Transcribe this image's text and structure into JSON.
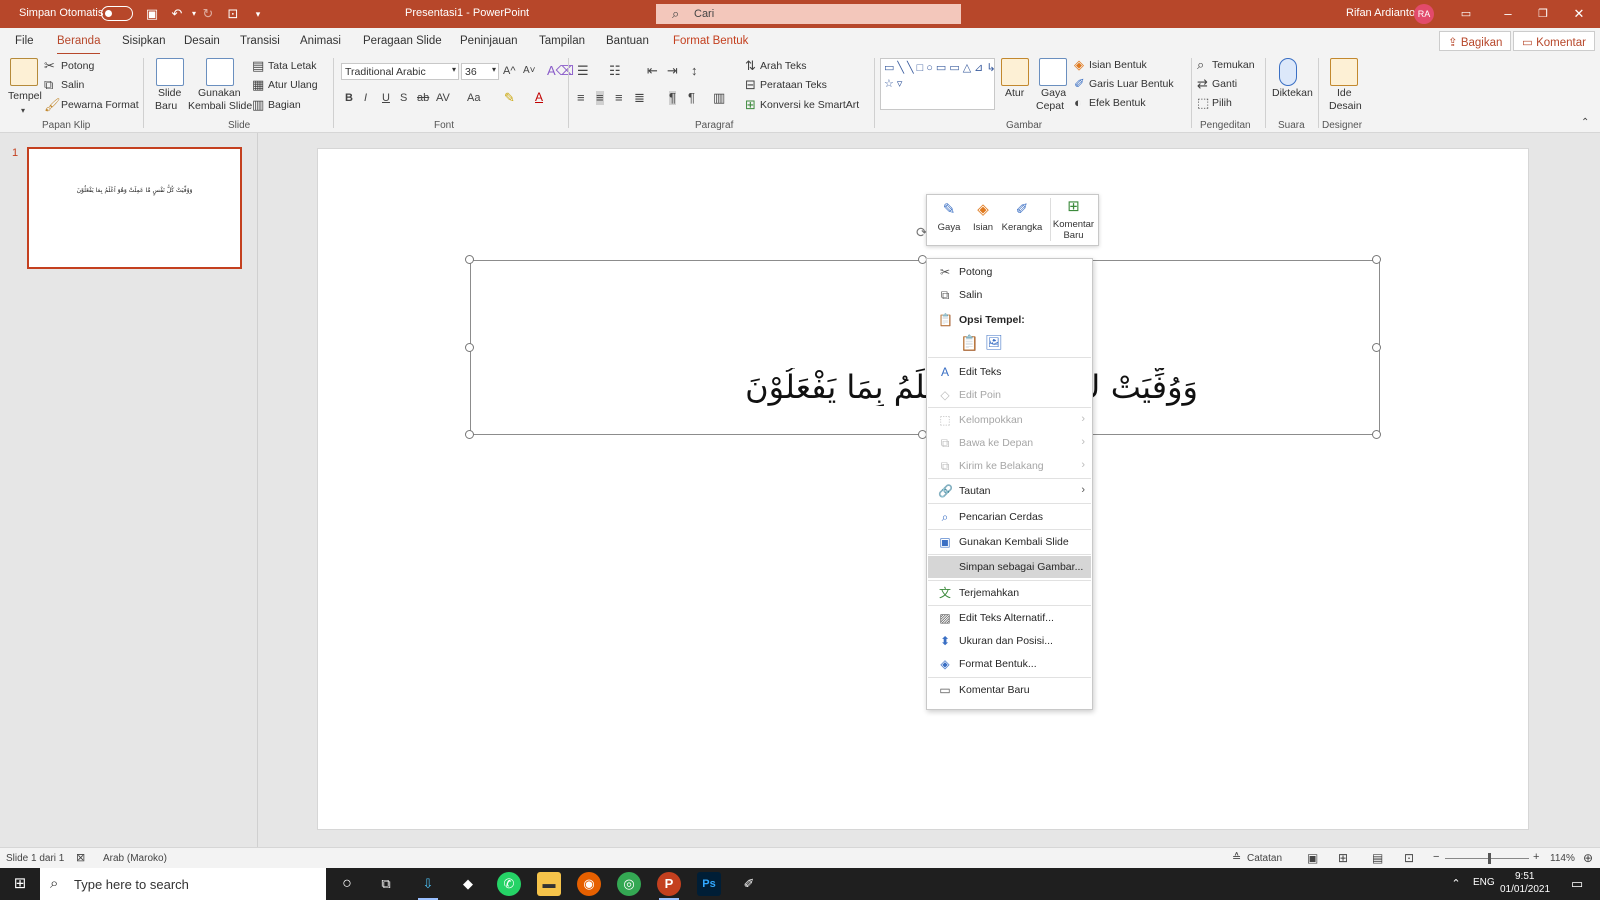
{
  "titlebar": {
    "autosave_label": "Simpan Otomatis",
    "doc_title": "Presentasi1  -  PowerPoint",
    "search_placeholder": "Cari",
    "user_name": "Rifan Ardianto",
    "user_initials": "RA",
    "colors": {
      "accent": "#b7472a"
    }
  },
  "tabs": [
    {
      "label": "File"
    },
    {
      "label": "Beranda",
      "active": true
    },
    {
      "label": "Sisipkan"
    },
    {
      "label": "Desain"
    },
    {
      "label": "Transisi"
    },
    {
      "label": "Animasi"
    },
    {
      "label": "Peragaan Slide"
    },
    {
      "label": "Peninjauan"
    },
    {
      "label": "Tampilan"
    },
    {
      "label": "Bantuan"
    },
    {
      "label": "Format Bentuk"
    }
  ],
  "share": {
    "bagikan": "Bagikan",
    "komentar": "Komentar"
  },
  "ribbon": {
    "clipboard": {
      "paste": "Tempel",
      "cut": "Potong",
      "copy": "Salin",
      "format_painter": "Pewarna Format",
      "group": "Papan Klip"
    },
    "slides": {
      "new_slide_1": "Slide",
      "new_slide_2": "Baru",
      "reuse_1": "Gunakan",
      "reuse_2": "Kembali Slide",
      "layout": "Tata Letak",
      "reset": "Atur Ulang",
      "section": "Bagian",
      "group": "Slide"
    },
    "font": {
      "name": "Traditional Arabic",
      "size": "36",
      "group": "Font"
    },
    "paragraph": {
      "text_direction": "Arah Teks",
      "align_text": "Perataan Teks",
      "smartart": "Konversi ke SmartArt",
      "group": "Paragraf"
    },
    "drawing": {
      "arrange": "Atur",
      "quick_styles_1": "Gaya",
      "quick_styles_2": "Cepat",
      "fill": "Isian Bentuk",
      "outline": "Garis Luar Bentuk",
      "effects": "Efek Bentuk",
      "group": "Gambar"
    },
    "editing": {
      "find": "Temukan",
      "replace": "Ganti",
      "select": "Pilih",
      "group": "Pengeditan"
    },
    "voice": {
      "dictate": "Diktekan",
      "group": "Suara"
    },
    "designer": {
      "ideas_1": "Ide",
      "ideas_2": "Desain",
      "group": "Designer"
    }
  },
  "thumbnail": {
    "number": "1",
    "text": "وَوُفِّيَتْ كُلُّ نَفْسٍ مَّا عَمِلَتْ وَهُوَ اَعْلَمُ بِمَا يَفْعَلُوْنَ"
  },
  "slide": {
    "text": "وَوُفِّيَتْ كُ لَتْ وَهُوَ اَعْلَمُ بِمَا يَفْعَلُوْنَ"
  },
  "mini_toolbar": {
    "style": "Gaya",
    "fill": "Isian",
    "outline": "Kerangka",
    "comment_1": "Komentar",
    "comment_2": "Baru"
  },
  "context_menu": [
    {
      "label": "Potong",
      "icon": "scissors-icon",
      "enabled": true
    },
    {
      "label": "Salin",
      "icon": "copy-icon",
      "enabled": true
    },
    {
      "label": "Opsi Tempel:",
      "icon": "paste-options-icon",
      "header": true
    },
    {
      "label": "Edit Teks",
      "icon": "edit-text-icon",
      "enabled": true
    },
    {
      "label": "Edit Poin",
      "icon": "edit-points-icon",
      "enabled": false
    },
    {
      "label": "Kelompokkan",
      "icon": "group-icon",
      "enabled": false,
      "submenu": true
    },
    {
      "label": "Bawa ke Depan",
      "icon": "bring-front-icon",
      "enabled": false,
      "submenu": true
    },
    {
      "label": "Kirim ke Belakang",
      "icon": "send-back-icon",
      "enabled": false,
      "submenu": true
    },
    {
      "label": "Tautan",
      "icon": "link-icon",
      "enabled": true,
      "submenu": true
    },
    {
      "label": "Pencarian Cerdas",
      "icon": "smart-lookup-icon",
      "enabled": true
    },
    {
      "label": "Gunakan Kembali Slide",
      "icon": "reuse-slides-icon",
      "enabled": true
    },
    {
      "label": "Simpan sebagai Gambar...",
      "icon": "",
      "enabled": true,
      "highlighted": true
    },
    {
      "label": "Terjemahkan",
      "icon": "translate-icon",
      "enabled": true
    },
    {
      "label": "Edit Teks Alternatif...",
      "icon": "alt-text-icon",
      "enabled": true
    },
    {
      "label": "Ukuran dan Posisi...",
      "icon": "size-position-icon",
      "enabled": true
    },
    {
      "label": "Format Bentuk...",
      "icon": "format-shape-icon",
      "enabled": true
    },
    {
      "label": "Komentar Baru",
      "icon": "new-comment-icon",
      "enabled": true
    }
  ],
  "status": {
    "slide_of": "Slide 1 dari 1",
    "language": "Arab (Maroko)",
    "notes": "Catatan",
    "zoom": "114%"
  },
  "taskbar": {
    "search_placeholder": "Type here to search",
    "lang": "ENG",
    "time": "9:51",
    "date": "01/01/2021"
  }
}
